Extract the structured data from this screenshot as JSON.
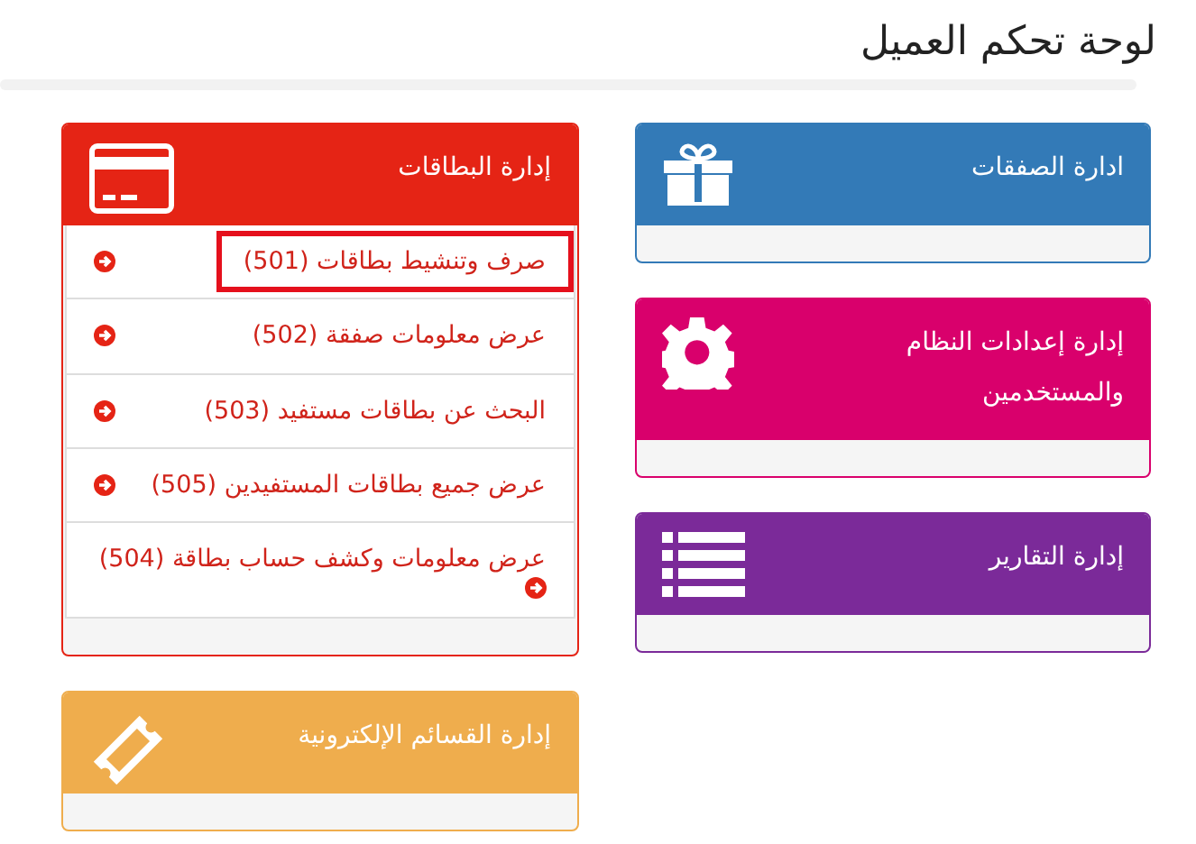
{
  "title": "لوحة تحكم العميل",
  "columns": [
    {
      "panels": [
        {
          "title": "ادارة الصفقات",
          "color": "#337ab7"
        },
        {
          "title": "إدارة إعدادات النظام والمستخدمين",
          "color": "#d9006c"
        },
        {
          "title": "إدارة التقارير",
          "color": "#7b2a99"
        }
      ]
    },
    {
      "panels": [
        {
          "title": "إدارة البطاقات",
          "color": "#e52415",
          "items": [
            {
              "label": "صرف وتنشيط بطاقات (501)",
              "highlighted": true
            },
            {
              "label": "عرض معلومات صفقة (502)",
              "highlighted": false
            },
            {
              "label": "البحث عن بطاقات مستفيد (503)",
              "highlighted": false
            },
            {
              "label": "عرض جميع بطاقات المستفيدين (505)",
              "highlighted": false
            },
            {
              "label": "عرض معلومات وكشف حساب بطاقة (504)",
              "highlighted": false
            }
          ]
        },
        {
          "title": "إدارة القسائم الإلكترونية",
          "color": "#efad4d"
        }
      ]
    }
  ]
}
